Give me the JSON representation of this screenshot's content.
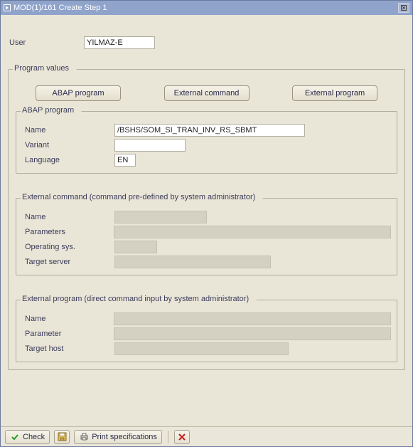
{
  "window": {
    "title": "MOD(1)/161 Create Step 1"
  },
  "user": {
    "label": "User",
    "value": "YILMAZ-E"
  },
  "program_values": {
    "legend": "Program values",
    "buttons": {
      "abap": "ABAP program",
      "ext_cmd": "External command",
      "ext_prog": "External program"
    },
    "abap_group": {
      "legend": "ABAP program",
      "name_label": "Name",
      "name_value": "/BSHS/SOM_SI_TRAN_INV_RS_SBMT",
      "variant_label": "Variant",
      "variant_value": "",
      "language_label": "Language",
      "language_value": "EN"
    },
    "extcmd_group": {
      "legend": "External command (command pre-defined by system administrator)",
      "name_label": "Name",
      "params_label": "Parameters",
      "os_label": "Operating sys.",
      "target_label": "Target server"
    },
    "extprog_group": {
      "legend": "External program (direct command input by system administrator)",
      "name_label": "Name",
      "param_label": "Parameter",
      "host_label": "Target host"
    }
  },
  "toolbar": {
    "check": "Check",
    "print": "Print specifications"
  }
}
